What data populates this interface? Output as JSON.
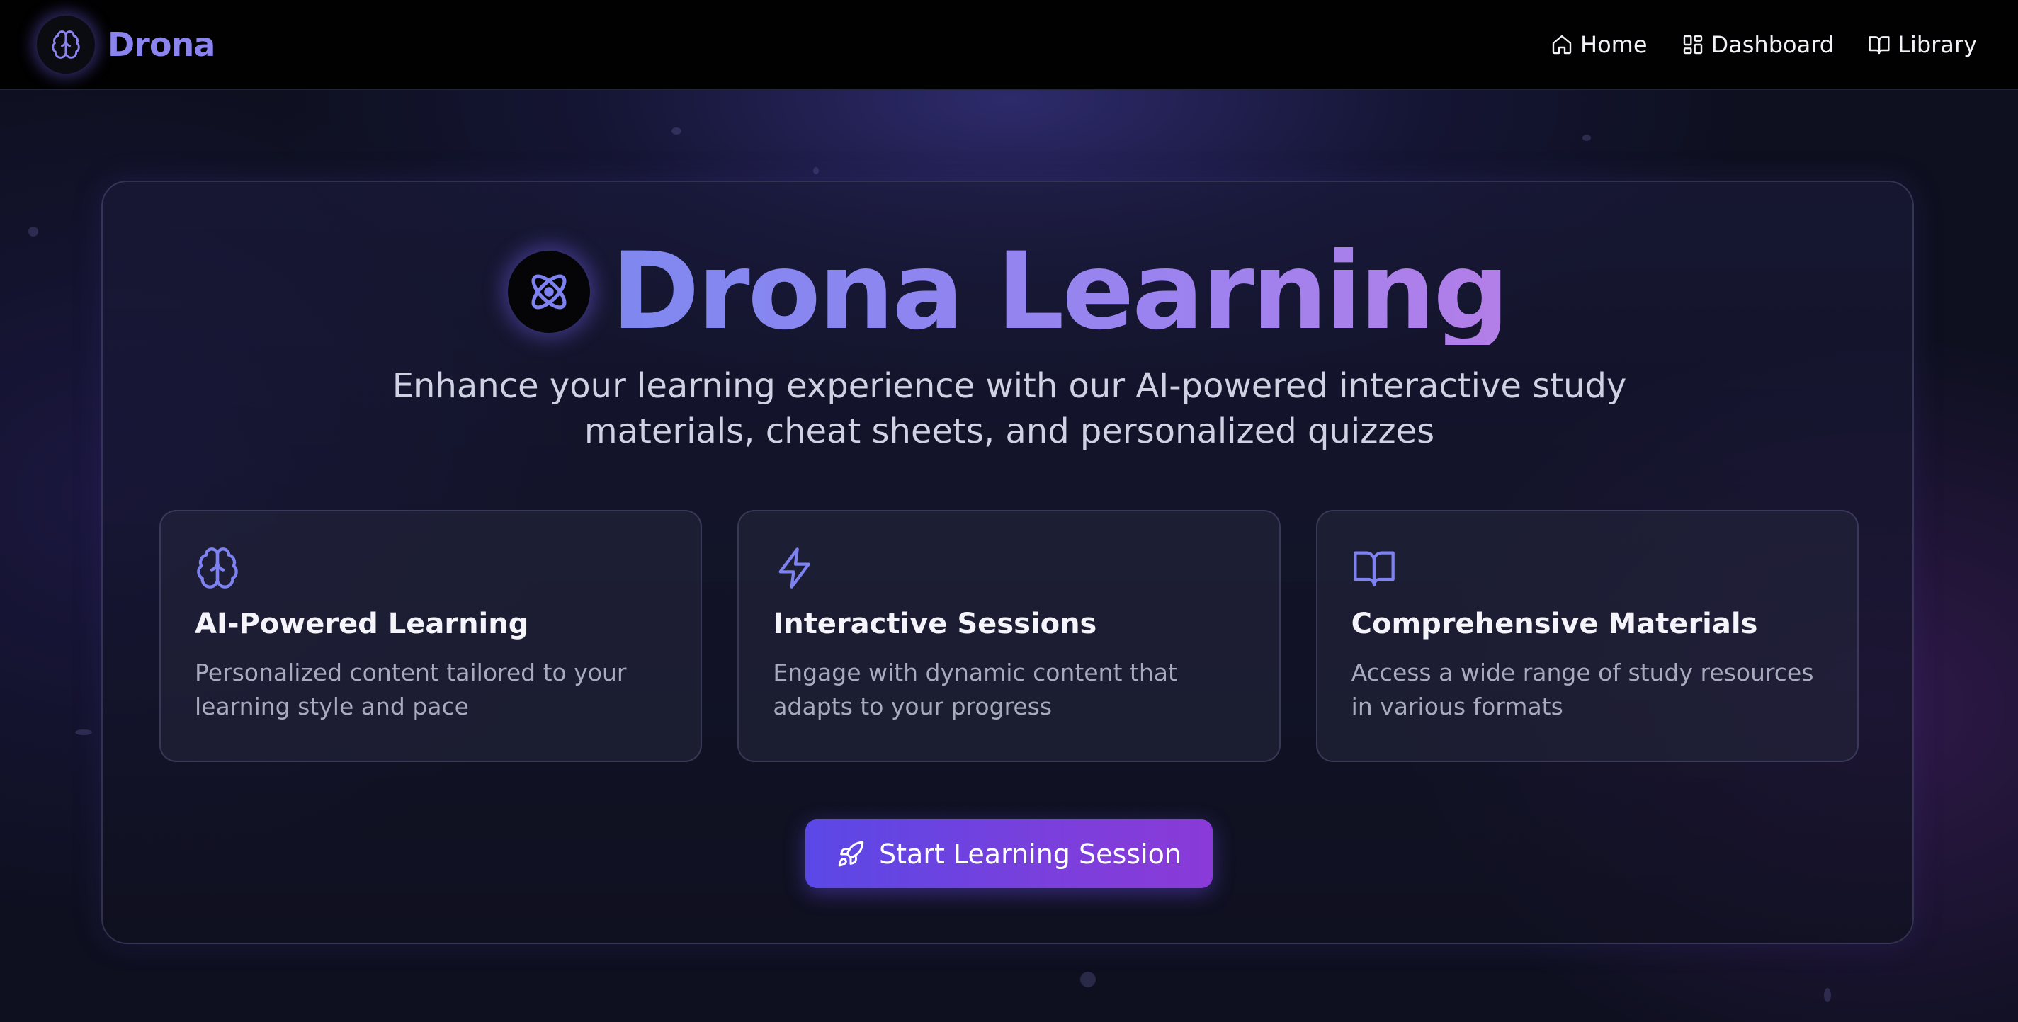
{
  "nav": {
    "brand": "Drona",
    "brand_icon": "brain-icon",
    "links": [
      {
        "label": "Home",
        "icon": "home-icon"
      },
      {
        "label": "Dashboard",
        "icon": "dashboard-icon"
      },
      {
        "label": "Library",
        "icon": "book-icon"
      }
    ]
  },
  "hero": {
    "title": "Drona Learning",
    "icon": "atom-icon",
    "subtitle": "Enhance your learning experience with our AI-powered interactive study materials, cheat sheets, and personalized quizzes"
  },
  "features": [
    {
      "icon": "brain-icon",
      "title": "AI-Powered Learning",
      "description": "Personalized content tailored to your learning style and pace"
    },
    {
      "icon": "lightning-icon",
      "title": "Interactive Sessions",
      "description": "Engage with dynamic content that adapts to your progress"
    },
    {
      "icon": "book-open-icon",
      "title": "Comprehensive Materials",
      "description": "Access a wide range of study resources in various formats"
    }
  ],
  "cta": {
    "label": "Start Learning Session",
    "icon": "rocket-icon"
  },
  "colors": {
    "accent": "#8b84ee",
    "icon": "#7d82f0",
    "button_start": "#5a48e6",
    "button_end": "#8a3ad8",
    "background": "#0e1020"
  }
}
